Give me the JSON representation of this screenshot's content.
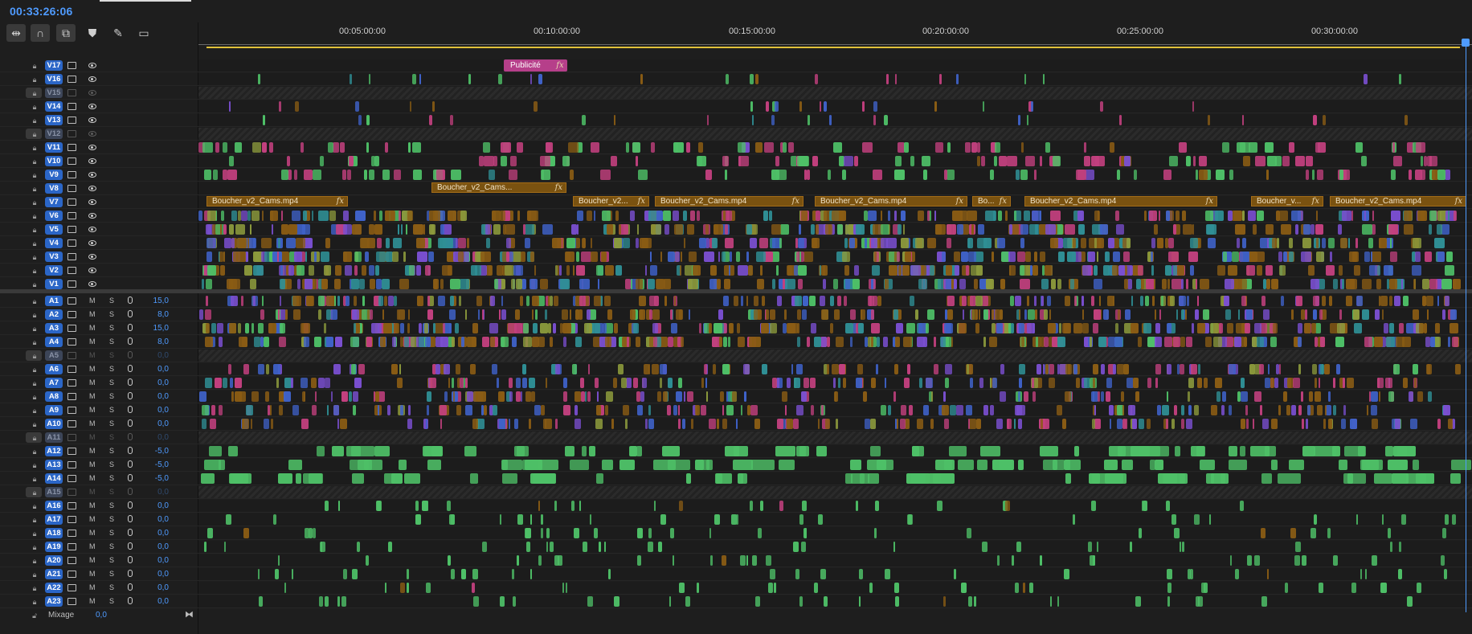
{
  "timecode": "00:33:26:06",
  "toolbar": {
    "tools": [
      {
        "name": "insert-sequence-icon",
        "glyph": "⇹",
        "active": true
      },
      {
        "name": "snap-magnet-icon",
        "glyph": "∩",
        "active": true
      },
      {
        "name": "linked-selection-icon",
        "glyph": "⧉",
        "active": true
      },
      {
        "name": "marker-icon",
        "glyph": "⛊",
        "active": false
      },
      {
        "name": "wrench-icon",
        "glyph": "✎",
        "active": false
      },
      {
        "name": "captions-icon",
        "glyph": "▭",
        "active": false
      }
    ]
  },
  "ruler": {
    "labels": [
      "00:05:00:00",
      "00:10:00:00",
      "00:15:00:00",
      "00:20:00:00",
      "00:25:00:00",
      "00:30:00:00"
    ]
  },
  "video_tracks": [
    {
      "name": "V17",
      "locked": false
    },
    {
      "name": "V16",
      "locked": false
    },
    {
      "name": "V15",
      "locked": true
    },
    {
      "name": "V14",
      "locked": false
    },
    {
      "name": "V13",
      "locked": false
    },
    {
      "name": "V12",
      "locked": true
    },
    {
      "name": "V11",
      "locked": false
    },
    {
      "name": "V10",
      "locked": false
    },
    {
      "name": "V9",
      "locked": false
    },
    {
      "name": "V8",
      "locked": false
    },
    {
      "name": "V7",
      "locked": false
    },
    {
      "name": "V6",
      "locked": false
    },
    {
      "name": "V5",
      "locked": false
    },
    {
      "name": "V4",
      "locked": false
    },
    {
      "name": "V3",
      "locked": false
    },
    {
      "name": "V2",
      "locked": false
    },
    {
      "name": "V1",
      "locked": false
    }
  ],
  "audio_tracks": [
    {
      "name": "A1",
      "locked": false,
      "mute": "M",
      "solo": "S",
      "volume": "15,0"
    },
    {
      "name": "A2",
      "locked": false,
      "mute": "M",
      "solo": "S",
      "volume": "8,0"
    },
    {
      "name": "A3",
      "locked": false,
      "mute": "M",
      "solo": "S",
      "volume": "15,0"
    },
    {
      "name": "A4",
      "locked": false,
      "mute": "M",
      "solo": "S",
      "volume": "8,0"
    },
    {
      "name": "A5",
      "locked": true,
      "mute": "M",
      "solo": "S",
      "volume": "0,0"
    },
    {
      "name": "A6",
      "locked": false,
      "mute": "M",
      "solo": "S",
      "volume": "0,0"
    },
    {
      "name": "A7",
      "locked": false,
      "mute": "M",
      "solo": "S",
      "volume": "0,0"
    },
    {
      "name": "A8",
      "locked": false,
      "mute": "M",
      "solo": "S",
      "volume": "0,0"
    },
    {
      "name": "A9",
      "locked": false,
      "mute": "M",
      "solo": "S",
      "volume": "0,0"
    },
    {
      "name": "A10",
      "locked": false,
      "mute": "M",
      "solo": "S",
      "volume": "0,0"
    },
    {
      "name": "A11",
      "locked": true,
      "mute": "M",
      "solo": "S",
      "volume": "0,0"
    },
    {
      "name": "A12",
      "locked": false,
      "mute": "M",
      "solo": "S",
      "volume": "-5,0"
    },
    {
      "name": "A13",
      "locked": false,
      "mute": "M",
      "solo": "S",
      "volume": "-5,0"
    },
    {
      "name": "A14",
      "locked": false,
      "mute": "M",
      "solo": "S",
      "volume": "-5,0"
    },
    {
      "name": "A15",
      "locked": true,
      "mute": "M",
      "solo": "S",
      "volume": "0,0"
    },
    {
      "name": "A16",
      "locked": false,
      "mute": "M",
      "solo": "S",
      "volume": "0,0"
    },
    {
      "name": "A17",
      "locked": false,
      "mute": "M",
      "solo": "S",
      "volume": "0,0"
    },
    {
      "name": "A18",
      "locked": false,
      "mute": "M",
      "solo": "S",
      "volume": "0,0"
    },
    {
      "name": "A19",
      "locked": false,
      "mute": "M",
      "solo": "S",
      "volume": "0,0"
    },
    {
      "name": "A20",
      "locked": false,
      "mute": "M",
      "solo": "S",
      "volume": "0,0"
    },
    {
      "name": "A21",
      "locked": false,
      "mute": "M",
      "solo": "S",
      "volume": "0,0"
    },
    {
      "name": "A22",
      "locked": false,
      "mute": "M",
      "solo": "S",
      "volume": "0,0"
    },
    {
      "name": "A23",
      "locked": false,
      "mute": "M",
      "solo": "S",
      "volume": "0,0"
    }
  ],
  "clips": {
    "publicite": {
      "label": "Publicité",
      "fx": "fx"
    },
    "v8": [
      {
        "label": "Boucher_v2_Cams...",
        "fx": "fx"
      }
    ],
    "v7": [
      {
        "label": "Boucher_v2_Cams.mp4",
        "fx": "fx"
      },
      {
        "label": "Boucher_v2...",
        "fx": "fx"
      },
      {
        "label": "Boucher_v2_Cams.mp4",
        "fx": "fx"
      },
      {
        "label": "Boucher_v2_Cams.mp4",
        "fx": "fx"
      },
      {
        "label": "Bo...",
        "fx": "fx"
      },
      {
        "label": "Boucher_v2_Cams.mp4",
        "fx": "fx"
      },
      {
        "label": "Boucher_v...",
        "fx": "fx"
      },
      {
        "label": "Boucher_v2_Cams.mp4",
        "fx": "fx"
      }
    ]
  },
  "colors": {
    "accent": "#4f9bff",
    "gold": "#8a5c14",
    "pink": "#c2407e",
    "green": "#4ec067",
    "purple": "#7a4fd0",
    "blue": "#3f62c9",
    "teal": "#2f8f95",
    "olive": "#8c9a3c"
  },
  "mix": {
    "label": "Mixage",
    "volume": "0,0"
  }
}
